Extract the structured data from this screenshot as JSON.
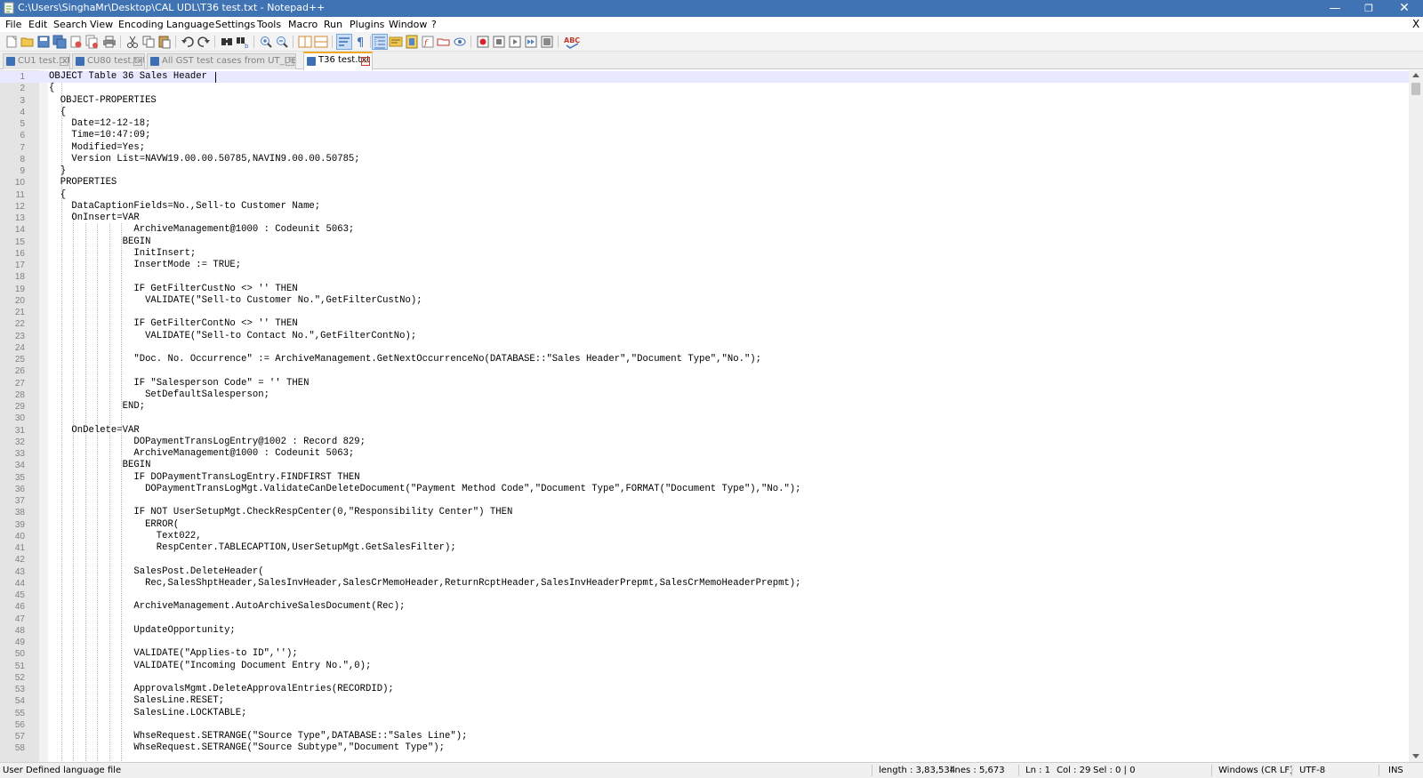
{
  "window": {
    "title": "C:\\Users\\SinghaMr\\Desktop\\CAL UDL\\T36 test.txt - Notepad++",
    "minimize": "—",
    "maximize": "❐",
    "close": "✕"
  },
  "menu": {
    "items": [
      "File",
      "Edit",
      "Search",
      "View",
      "Encoding",
      "Language",
      "Settings",
      "Tools",
      "Macro",
      "Run",
      "Plugins",
      "Window",
      "?"
    ],
    "close_doc": "X"
  },
  "tabs": [
    {
      "label": "CU1 test.txt",
      "active": false
    },
    {
      "label": "CU80 test.txt",
      "active": false
    },
    {
      "label": "All GST test cases from UT_DEV.txt",
      "active": false
    },
    {
      "label": "T36 test.txt",
      "active": true
    }
  ],
  "toolbar": {
    "icons": [
      "new-file-icon",
      "open-file-icon",
      "save-icon",
      "save-all-icon",
      "close-icon",
      "close-all-icon",
      "print-icon",
      "cut-icon",
      "copy-icon",
      "paste-icon",
      "undo-icon",
      "redo-icon",
      "find-icon",
      "replace-icon",
      "zoom-in-icon",
      "zoom-out-icon",
      "sync-vertical-icon",
      "sync-horizontal-icon",
      "word-wrap-icon",
      "show-all-chars-icon",
      "indent-guide-icon",
      "udl-icon",
      "doc-map-icon",
      "function-list-icon",
      "folder-as-workspace-icon",
      "monitoring-icon",
      "record-macro-icon",
      "stop-macro-icon",
      "play-macro-icon",
      "run-macro-multiple-icon",
      "save-macro-icon",
      "spell-check-icon"
    ],
    "spell_label": "ABC"
  },
  "editor": {
    "lines": [
      "OBJECT Table 36 Sales Header",
      "{",
      "  OBJECT-PROPERTIES",
      "  {",
      "    Date=12-12-18;",
      "    Time=10:47:09;",
      "    Modified=Yes;",
      "    Version List=NAVW19.00.00.50785,NAVIN9.00.00.50785;",
      "  }",
      "  PROPERTIES",
      "  {",
      "    DataCaptionFields=No.,Sell-to Customer Name;",
      "    OnInsert=VAR",
      "               ArchiveManagement@1000 : Codeunit 5063;",
      "             BEGIN",
      "               InitInsert;",
      "               InsertMode := TRUE;",
      "",
      "               IF GetFilterCustNo <> '' THEN",
      "                 VALIDATE(\"Sell-to Customer No.\",GetFilterCustNo);",
      "",
      "               IF GetFilterContNo <> '' THEN",
      "                 VALIDATE(\"Sell-to Contact No.\",GetFilterContNo);",
      "",
      "               \"Doc. No. Occurrence\" := ArchiveManagement.GetNextOccurrenceNo(DATABASE::\"Sales Header\",\"Document Type\",\"No.\");",
      "",
      "               IF \"Salesperson Code\" = '' THEN",
      "                 SetDefaultSalesperson;",
      "             END;",
      "",
      "    OnDelete=VAR",
      "               DOPaymentTransLogEntry@1002 : Record 829;",
      "               ArchiveManagement@1000 : Codeunit 5063;",
      "             BEGIN",
      "               IF DOPaymentTransLogEntry.FINDFIRST THEN",
      "                 DOPaymentTransLogMgt.ValidateCanDeleteDocument(\"Payment Method Code\",\"Document Type\",FORMAT(\"Document Type\"),\"No.\");",
      "",
      "               IF NOT UserSetupMgt.CheckRespCenter(0,\"Responsibility Center\") THEN",
      "                 ERROR(",
      "                   Text022,",
      "                   RespCenter.TABLECAPTION,UserSetupMgt.GetSalesFilter);",
      "",
      "               SalesPost.DeleteHeader(",
      "                 Rec,SalesShptHeader,SalesInvHeader,SalesCrMemoHeader,ReturnRcptHeader,SalesInvHeaderPrepmt,SalesCrMemoHeaderPrepmt);",
      "",
      "               ArchiveManagement.AutoArchiveSalesDocument(Rec);",
      "",
      "               UpdateOpportunity;",
      "",
      "               VALIDATE(\"Applies-to ID\",'');",
      "               VALIDATE(\"Incoming Document Entry No.\",0);",
      "",
      "               ApprovalsMgmt.DeleteApprovalEntries(RECORDID);",
      "               SalesLine.RESET;",
      "               SalesLine.LOCKTABLE;",
      "",
      "               WhseRequest.SETRANGE(\"Source Type\",DATABASE::\"Sales Line\");",
      "               WhseRequest.SETRANGE(\"Source Subtype\",\"Document Type\");"
    ]
  },
  "status": {
    "language": "User Defined language file",
    "length": "length : 3,83,534",
    "lines": "lines : 5,673",
    "ln": "Ln : 1",
    "col": "Col : 29",
    "sel": "Sel : 0 | 0",
    "eol": "Windows (CR LF)",
    "encoding": "UTF-8",
    "mode": "INS"
  }
}
